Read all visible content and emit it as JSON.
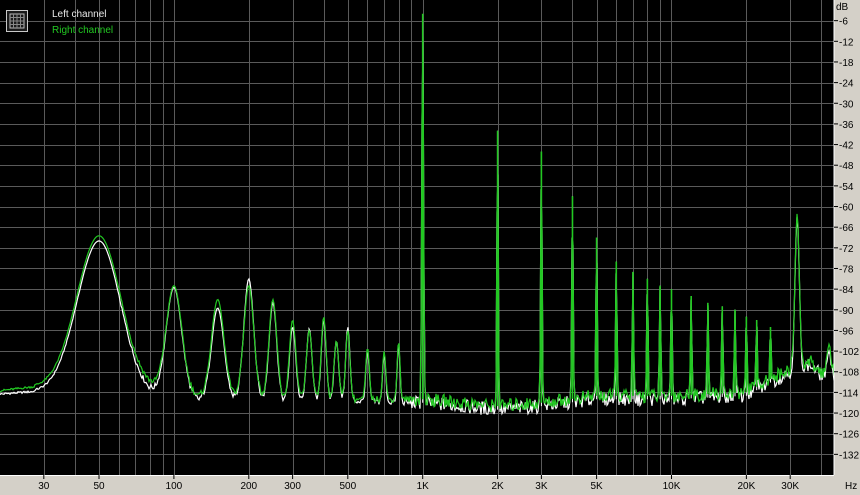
{
  "legend": {
    "left_label": "Left channel",
    "right_label": "Right channel",
    "icon": "grid-chart-icon"
  },
  "colors": {
    "background": "#000000",
    "grid": "#5a5a5a",
    "panel": "#d4d0c8",
    "left_channel": "#ffffff",
    "right_channel": "#22c822",
    "text": "#000000"
  },
  "chart_data": {
    "type": "line",
    "xlabel": "Hz",
    "ylabel": "dB",
    "x_scale": "log",
    "xlim": [
      20,
      45000
    ],
    "ylim": [
      -138,
      0
    ],
    "grid": true,
    "legend_position": "top-left",
    "x_ticks": [
      {
        "value": 30,
        "label": "30"
      },
      {
        "value": 50,
        "label": "50"
      },
      {
        "value": 100,
        "label": "100"
      },
      {
        "value": 200,
        "label": "200"
      },
      {
        "value": 300,
        "label": "300"
      },
      {
        "value": 500,
        "label": "500"
      },
      {
        "value": 1000,
        "label": "1K"
      },
      {
        "value": 2000,
        "label": "2K"
      },
      {
        "value": 3000,
        "label": "3K"
      },
      {
        "value": 5000,
        "label": "5K"
      },
      {
        "value": 10000,
        "label": "10K"
      },
      {
        "value": 20000,
        "label": "20K"
      },
      {
        "value": 30000,
        "label": "30K"
      }
    ],
    "y_ticks": [
      -6,
      -12,
      -18,
      -24,
      -30,
      -36,
      -42,
      -48,
      -54,
      -60,
      -66,
      -72,
      -78,
      -84,
      -90,
      -96,
      -102,
      -108,
      -114,
      -120,
      -126,
      -132
    ],
    "series": [
      {
        "name": "Left channel",
        "color": "#ffffff",
        "floor": [
          [
            20,
            -114.5
          ],
          [
            30,
            -113.5
          ],
          [
            40,
            -112
          ],
          [
            45,
            -111.5
          ],
          [
            62,
            -114.5
          ],
          [
            80,
            -115
          ],
          [
            100,
            -116
          ],
          [
            150,
            -116
          ],
          [
            200,
            -116
          ],
          [
            300,
            -117
          ],
          [
            500,
            -116.5
          ],
          [
            1000,
            -117
          ],
          [
            2000,
            -119
          ],
          [
            3000,
            -118
          ],
          [
            5000,
            -116
          ],
          [
            10000,
            -116
          ],
          [
            20000,
            -115
          ],
          [
            30000,
            -108
          ],
          [
            36000,
            -106
          ],
          [
            40000,
            -109
          ],
          [
            45000,
            -109
          ]
        ],
        "peaks": [
          {
            "x": 50,
            "y": -70,
            "w": 0.12
          },
          {
            "x": 100,
            "y": -83.5,
            "w": 0.045
          },
          {
            "x": 150,
            "y": -89.5,
            "w": 0.035
          },
          {
            "x": 200,
            "y": -81,
            "w": 0.028
          },
          {
            "x": 250,
            "y": -88,
            "w": 0.022
          },
          {
            "x": 300,
            "y": -95,
            "w": 0.018
          },
          {
            "x": 350,
            "y": -95.5,
            "w": 0.016
          },
          {
            "x": 400,
            "y": -93,
            "w": 0.014
          },
          {
            "x": 450,
            "y": -99,
            "w": 0.013
          },
          {
            "x": 500,
            "y": -95,
            "w": 0.012
          },
          {
            "x": 600,
            "y": -102,
            "w": 0.01
          },
          {
            "x": 700,
            "y": -103,
            "w": 0.009
          },
          {
            "x": 800,
            "y": -100,
            "w": 0.008
          },
          {
            "x": 1000,
            "y": -5,
            "w": 0.005
          },
          {
            "x": 2000,
            "y": -38,
            "w": 0.004
          },
          {
            "x": 3000,
            "y": -44,
            "w": 0.004
          },
          {
            "x": 4000,
            "y": -57,
            "w": 0.004
          },
          {
            "x": 5000,
            "y": -69,
            "w": 0.004
          },
          {
            "x": 6000,
            "y": -76,
            "w": 0.004
          },
          {
            "x": 7000,
            "y": -79,
            "w": 0.004
          },
          {
            "x": 8000,
            "y": -81,
            "w": 0.004
          },
          {
            "x": 9000,
            "y": -83,
            "w": 0.004
          },
          {
            "x": 10000,
            "y": -84,
            "w": 0.004
          },
          {
            "x": 12000,
            "y": -86,
            "w": 0.004
          },
          {
            "x": 14000,
            "y": -88,
            "w": 0.004
          },
          {
            "x": 16000,
            "y": -89,
            "w": 0.004
          },
          {
            "x": 18000,
            "y": -90,
            "w": 0.004
          },
          {
            "x": 20000,
            "y": -92,
            "w": 0.004
          },
          {
            "x": 22000,
            "y": -93,
            "w": 0.004
          },
          {
            "x": 25000,
            "y": -95,
            "w": 0.004
          },
          {
            "x": 32000,
            "y": -63,
            "w": 0.012
          },
          {
            "x": 43000,
            "y": -102,
            "w": 0.01
          }
        ]
      },
      {
        "name": "Right channel",
        "color": "#22c822",
        "floor": [
          [
            20,
            -113.5
          ],
          [
            30,
            -112
          ],
          [
            40,
            -110
          ],
          [
            45,
            -109
          ],
          [
            62,
            -112
          ],
          [
            80,
            -113
          ],
          [
            100,
            -115
          ],
          [
            150,
            -115
          ],
          [
            200,
            -115
          ],
          [
            300,
            -116
          ],
          [
            500,
            -116
          ],
          [
            1000,
            -116
          ],
          [
            2000,
            -118
          ],
          [
            3000,
            -117
          ],
          [
            5000,
            -115
          ],
          [
            10000,
            -115
          ],
          [
            20000,
            -114
          ],
          [
            30000,
            -107
          ],
          [
            36000,
            -105
          ],
          [
            40000,
            -108
          ],
          [
            45000,
            -108
          ]
        ],
        "peaks": [
          {
            "x": 50,
            "y": -68.5,
            "w": 0.12
          },
          {
            "x": 100,
            "y": -83,
            "w": 0.045
          },
          {
            "x": 150,
            "y": -87,
            "w": 0.035
          },
          {
            "x": 200,
            "y": -83,
            "w": 0.028
          },
          {
            "x": 250,
            "y": -87,
            "w": 0.022
          },
          {
            "x": 300,
            "y": -93,
            "w": 0.018
          },
          {
            "x": 350,
            "y": -96,
            "w": 0.016
          },
          {
            "x": 400,
            "y": -92,
            "w": 0.014
          },
          {
            "x": 450,
            "y": -99,
            "w": 0.013
          },
          {
            "x": 500,
            "y": -96,
            "w": 0.012
          },
          {
            "x": 600,
            "y": -101,
            "w": 0.01
          },
          {
            "x": 700,
            "y": -102,
            "w": 0.009
          },
          {
            "x": 800,
            "y": -99,
            "w": 0.008
          },
          {
            "x": 1000,
            "y": -4,
            "w": 0.005
          },
          {
            "x": 2000,
            "y": -38,
            "w": 0.004
          },
          {
            "x": 3000,
            "y": -44,
            "w": 0.004
          },
          {
            "x": 4000,
            "y": -57,
            "w": 0.004
          },
          {
            "x": 5000,
            "y": -69,
            "w": 0.004
          },
          {
            "x": 6000,
            "y": -76,
            "w": 0.004
          },
          {
            "x": 7000,
            "y": -79,
            "w": 0.004
          },
          {
            "x": 8000,
            "y": -81,
            "w": 0.004
          },
          {
            "x": 9000,
            "y": -83,
            "w": 0.004
          },
          {
            "x": 10000,
            "y": -84,
            "w": 0.004
          },
          {
            "x": 12000,
            "y": -86,
            "w": 0.004
          },
          {
            "x": 14000,
            "y": -88,
            "w": 0.004
          },
          {
            "x": 16000,
            "y": -89,
            "w": 0.004
          },
          {
            "x": 18000,
            "y": -90,
            "w": 0.004
          },
          {
            "x": 20000,
            "y": -92,
            "w": 0.004
          },
          {
            "x": 22000,
            "y": -93,
            "w": 0.004
          },
          {
            "x": 25000,
            "y": -95,
            "w": 0.004
          },
          {
            "x": 32000,
            "y": -62,
            "w": 0.012
          },
          {
            "x": 43000,
            "y": -100,
            "w": 0.01
          }
        ]
      }
    ]
  }
}
